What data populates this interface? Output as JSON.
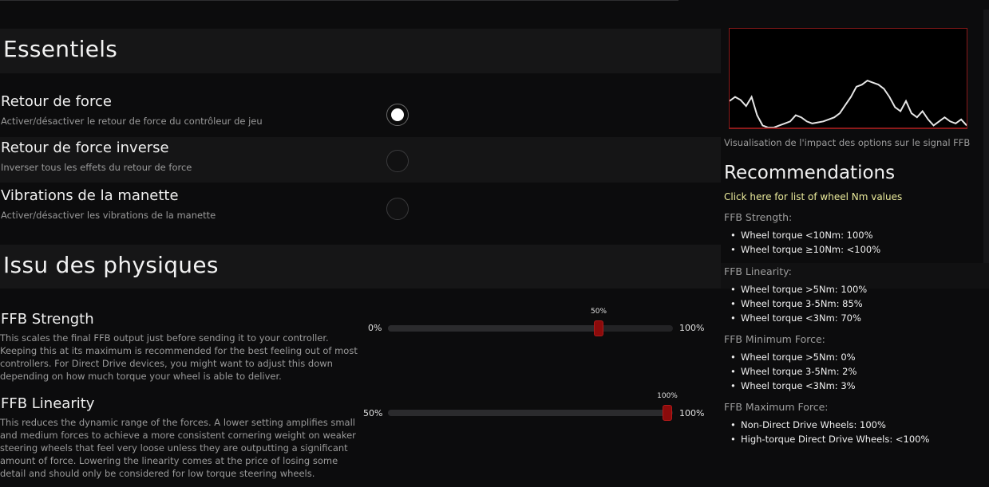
{
  "sections": {
    "essentials": "Essentiels",
    "physics": "Issu des physiques"
  },
  "toggles": [
    {
      "label": "Retour de force",
      "desc": "Activer/désactiver le retour de force du contrôleur de jeu",
      "on": true
    },
    {
      "label": "Retour de force inverse",
      "desc": "Inverser tous les effets du retour de force",
      "on": false
    },
    {
      "label": "Vibrations de la manette",
      "desc": "Activer/désactiver les vibrations de la manette",
      "on": false
    }
  ],
  "sliders": [
    {
      "label": "FFB Strength",
      "desc": "This scales the final FFB output just before sending it to your controller. Keeping this at its maximum is recommended for the best feeling out of most controllers. For Direct Drive devices, you might want to adjust this down depending on how much torque your wheel is able to deliver.",
      "min_label": "0%",
      "max_label": "100%",
      "value_label": "50%",
      "min": 0,
      "max": 100,
      "value": 50
    },
    {
      "label": "FFB Linearity",
      "desc": "This reduces the dynamic range of the forces. A lower setting amplifies small and medium forces to achieve a more consistent cornering weight on weaker steering wheels that feel very loose unless they are outputting a significant amount of force. Lowering the linearity comes at the price of losing some detail and should only be considered for low torque steering wheels.",
      "min_label": "50%",
      "max_label": "100%",
      "value_label": "100%",
      "min": 50,
      "max": 100,
      "value": 100
    }
  ],
  "graph": {
    "caption": "Visualisation de l'impact des options sur le signal FFB",
    "border_color": "#8b1a1a",
    "signal": [
      0.26,
      0.3,
      0.27,
      0.21,
      0.3,
      0.12,
      0.02,
      0.0,
      0.0,
      0.02,
      0.04,
      0.06,
      0.12,
      0.1,
      0.06,
      0.04,
      0.05,
      0.06,
      0.08,
      0.1,
      0.14,
      0.22,
      0.3,
      0.4,
      0.42,
      0.46,
      0.44,
      0.42,
      0.38,
      0.3,
      0.2,
      0.16,
      0.26,
      0.14,
      0.1,
      0.16,
      0.08,
      0.02,
      0.06,
      0.1,
      0.06,
      0.04,
      0.08,
      0.02
    ]
  },
  "recommendations": {
    "title": "Recommendations",
    "link": "Click here for list of wheel Nm values",
    "groups": [
      {
        "title": "FFB Strength:",
        "items": [
          "Wheel torque <10Nm: 100%",
          "Wheel torque ≥10Nm: <100%"
        ]
      },
      {
        "title": "FFB Linearity:",
        "items": [
          "Wheel torque >5Nm: 100%",
          "Wheel torque 3-5Nm: 85%",
          "Wheel torque <3Nm: 70%"
        ]
      },
      {
        "title": "FFB Minimum Force:",
        "items": [
          "Wheel torque >5Nm: 0%",
          "Wheel torque 3-5Nm: 2%",
          "Wheel torque <3Nm: 3%"
        ]
      },
      {
        "title": "FFB Maximum Force:",
        "items": [
          "Non-Direct Drive Wheels: 100%",
          "High-torque Direct Drive Wheels: <100%"
        ]
      }
    ]
  },
  "colors": {
    "accent_thumb": "#8b0b0b",
    "link": "#ecec9c"
  }
}
